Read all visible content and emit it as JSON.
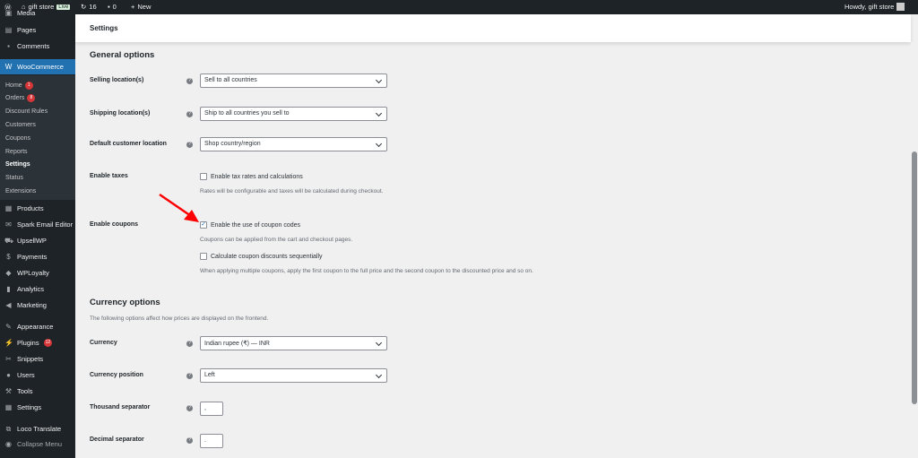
{
  "topbar": {
    "site": "gift store",
    "live": "Live",
    "updates": "16",
    "comments": "0",
    "new": "New",
    "howdy": "Howdy, gift store"
  },
  "sidebar": {
    "items": [
      {
        "label": "Media",
        "icon": "media-icon"
      },
      {
        "label": "Pages",
        "icon": "pages-icon"
      },
      {
        "label": "Comments",
        "icon": "comments-icon"
      },
      {
        "label": "WooCommerce",
        "icon": "woocommerce-icon"
      },
      {
        "label": "Products",
        "icon": "products-icon"
      },
      {
        "label": "Spark Email Editor",
        "icon": "email-icon"
      },
      {
        "label": "UpsellWP",
        "icon": "cart-icon"
      },
      {
        "label": "Payments",
        "icon": "payments-icon"
      },
      {
        "label": "WPLoyalty",
        "icon": "loyalty-icon"
      },
      {
        "label": "Analytics",
        "icon": "analytics-icon"
      },
      {
        "label": "Marketing",
        "icon": "megaphone-icon"
      },
      {
        "label": "Appearance",
        "icon": "brush-icon"
      },
      {
        "label": "Plugins",
        "icon": "plugin-icon",
        "badge": "12"
      },
      {
        "label": "Snippets",
        "icon": "scissors-icon"
      },
      {
        "label": "Users",
        "icon": "users-icon"
      },
      {
        "label": "Tools",
        "icon": "wrench-icon"
      },
      {
        "label": "Settings",
        "icon": "settings-icon"
      },
      {
        "label": "Loco Translate",
        "icon": "translate-icon"
      },
      {
        "label": "Collapse Menu",
        "icon": "collapse-icon"
      }
    ],
    "submenu": [
      {
        "label": "Home",
        "badge": "1"
      },
      {
        "label": "Orders",
        "badge": "8"
      },
      {
        "label": "Discount Rules"
      },
      {
        "label": "Customers"
      },
      {
        "label": "Coupons"
      },
      {
        "label": "Reports"
      },
      {
        "label": "Settings",
        "current": true
      },
      {
        "label": "Status"
      },
      {
        "label": "Extensions"
      }
    ]
  },
  "header": {
    "title": "Settings"
  },
  "general": {
    "title": "General options",
    "selling": {
      "label": "Selling location(s)",
      "value": "Sell to all countries"
    },
    "shipping": {
      "label": "Shipping location(s)",
      "value": "Ship to all countries you sell to"
    },
    "default_loc": {
      "label": "Default customer location",
      "value": "Shop country/region"
    },
    "taxes": {
      "label": "Enable taxes",
      "checkbox": "Enable tax rates and calculations",
      "checked": false,
      "desc": "Rates will be configurable and taxes will be calculated during checkout."
    },
    "coupons": {
      "label": "Enable coupons",
      "checkbox": "Enable the use of coupon codes",
      "checked": true,
      "desc": "Coupons can be applied from the cart and checkout pages.",
      "seq_checkbox": "Calculate coupon discounts sequentially",
      "seq_checked": false,
      "seq_desc": "When applying multiple coupons, apply the first coupon to the full price and the second coupon to the discounted price and so on."
    }
  },
  "currency": {
    "title": "Currency options",
    "desc": "The following options affect how prices are displayed on the frontend.",
    "currency": {
      "label": "Currency",
      "value": "Indian rupee (₹) — INR"
    },
    "position": {
      "label": "Currency position",
      "value": "Left"
    },
    "thousand": {
      "label": "Thousand separator",
      "value": ","
    },
    "decimal": {
      "label": "Decimal separator",
      "value": "."
    }
  },
  "annotation_color": "#ff0000"
}
